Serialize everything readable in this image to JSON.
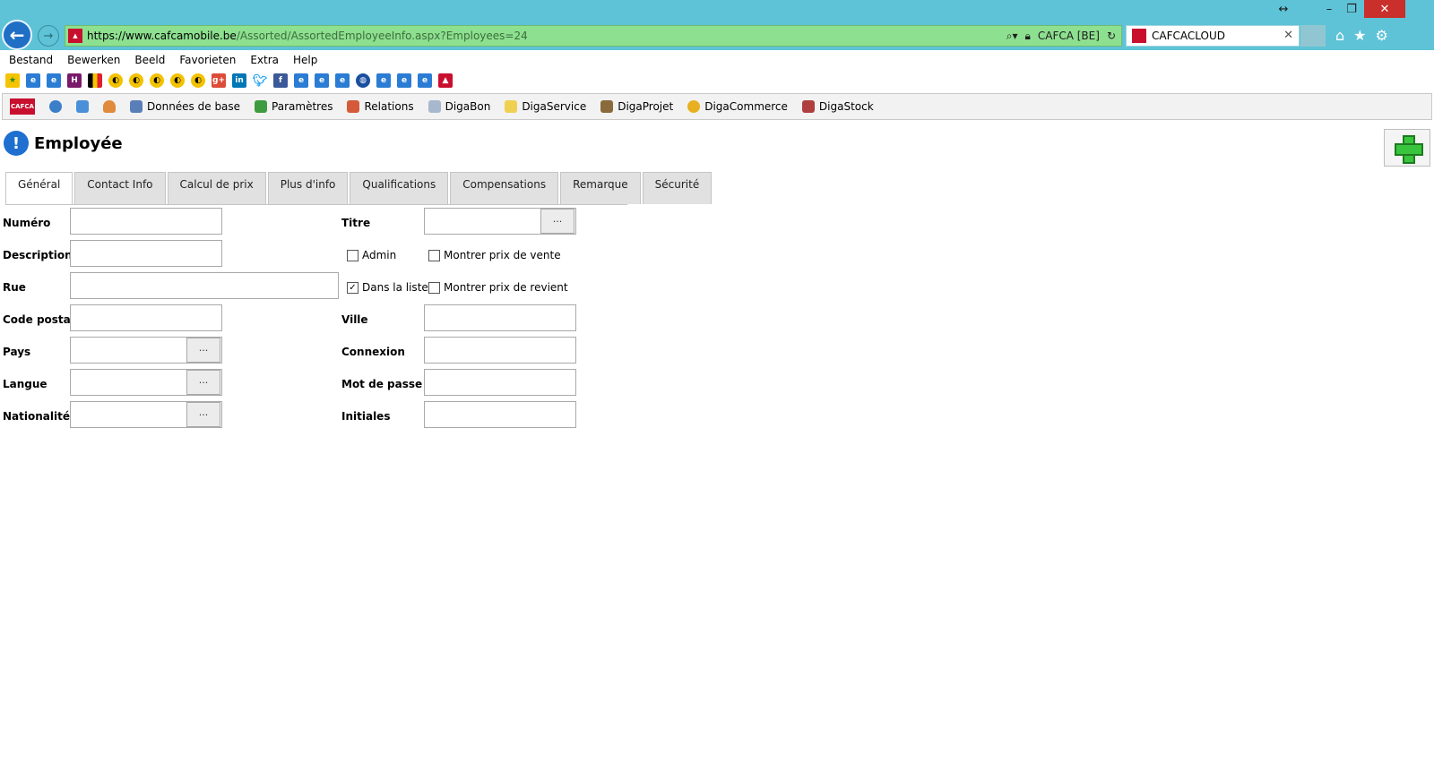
{
  "browser": {
    "url_host": "https://www.cafcamobile.be",
    "url_path": "/Assorted/AssortedEmployeeInfo.aspx?Employees=24",
    "site_badge": "CAFCA [BE]",
    "tab_title": "CAFCACLOUD"
  },
  "menu": [
    "Bestand",
    "Bewerken",
    "Beeld",
    "Favorieten",
    "Extra",
    "Help"
  ],
  "toolbar": {
    "items": [
      "Données de base",
      "Paramètres",
      "Relations",
      "DigaBon",
      "DigaService",
      "DigaProjet",
      "DigaCommerce",
      "DigaStock"
    ]
  },
  "page": {
    "title": "Employée",
    "tabs": [
      "Général",
      "Contact Info",
      "Calcul de prix",
      "Plus d'info",
      "Qualifications",
      "Compensations",
      "Remarque",
      "Sécurité"
    ]
  },
  "form": {
    "numero": "Numéro",
    "description": "Description",
    "rue": "Rue",
    "code_postal": "Code postal",
    "pays": "Pays",
    "langue": "Langue",
    "nationalite": "Nationalité",
    "titre": "Titre",
    "ville": "Ville",
    "connexion": "Connexion",
    "mot_de_passe": "Mot de passe",
    "initiales": "Initiales",
    "admin": "Admin",
    "dans_la_liste": "Dans la liste",
    "montrer_prix_vente": "Montrer prix de vente",
    "montrer_prix_revient": "Montrer prix de revient",
    "ellipsis": "···"
  }
}
